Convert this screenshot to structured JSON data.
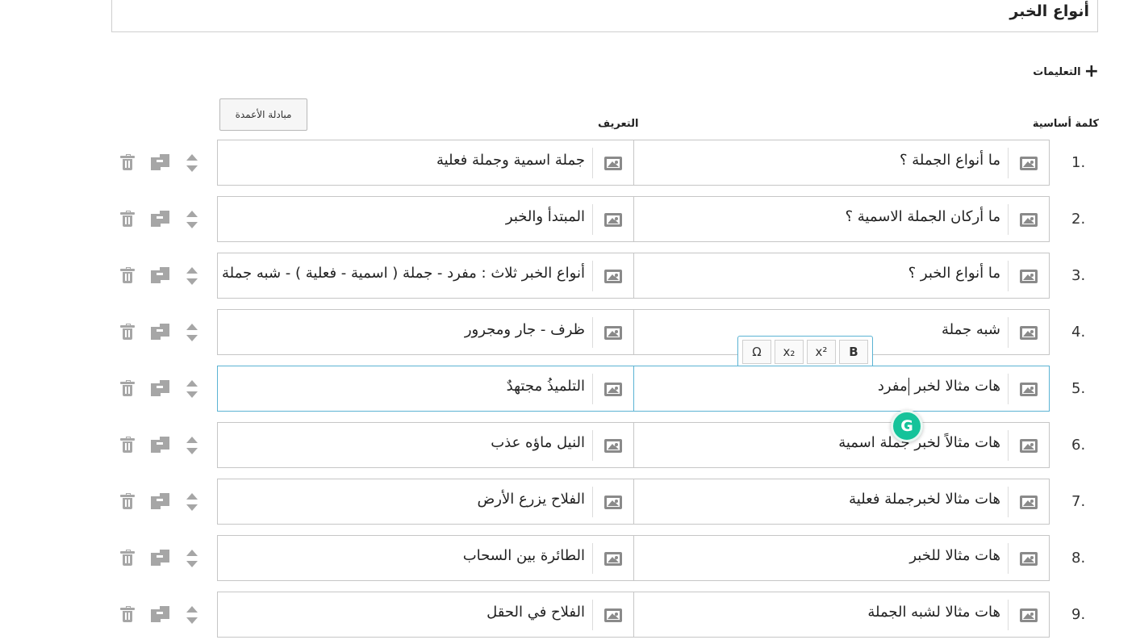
{
  "page": {
    "title": "أنواع الخبر"
  },
  "instructions": {
    "icon": "plus-icon",
    "label": "التعليمات"
  },
  "swap_button": {
    "label": "مبادلة الأعمدة"
  },
  "columns": {
    "keyword": "كلمة أساسية",
    "definition": "التعريف"
  },
  "format_toolbar": {
    "omega": "Ω",
    "subscript": "x₂",
    "superscript": "x²",
    "bold": "B"
  },
  "grammarly": {
    "label": "G"
  },
  "rows": [
    {
      "num": "1.",
      "term": "ما أنواع الجملة  ؟",
      "definition": "جملة اسمية وجملة فعلية"
    },
    {
      "num": "2.",
      "term": "ما أركان الجملة الاسمية ؟",
      "definition": "المبتدأ والخبر"
    },
    {
      "num": "3.",
      "term": "ما أنواع الخبر ؟",
      "definition": "أنواع الخبر ثلاث : مفرد - جملة ( اسمية - فعلية ) - شبه جملة"
    },
    {
      "num": "4.",
      "term": "شبه جملة",
      "definition": "ظرف - جار ومجرور"
    },
    {
      "num": "5.",
      "term_before": "هات مثالا لخبر",
      "term_after": "مفرد",
      "definition": "التلميذُ مجتهدٌ"
    },
    {
      "num": "6.",
      "term": "هات مثالاً لخبر جملة اسمية",
      "definition": "النيل ماؤه عذب"
    },
    {
      "num": "7.",
      "term": "هات مثالا لخبرجملة فعلية",
      "definition": "الفلاح يزرع الأرض"
    },
    {
      "num": "8.",
      "term": "هات مثالا للخبر",
      "definition": "الطائرة بين السحاب"
    },
    {
      "num": "9.",
      "term": "هات مثالا لشبه الجملة",
      "definition": "الفلاح في الحقل"
    }
  ]
}
